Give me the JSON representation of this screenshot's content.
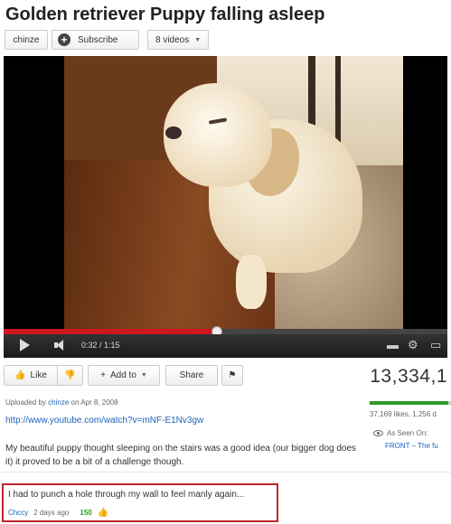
{
  "video": {
    "title": "Golden retriever Puppy falling asleep",
    "channel": "chinze",
    "subscribe_label": "Subscribe",
    "videos_label": "8 videos",
    "progress_fraction": 0.48
  },
  "player": {
    "time": "0:32 / 1:15"
  },
  "actions": {
    "like_label": "Like",
    "add_to_label": "Add to",
    "share_label": "Share"
  },
  "stats": {
    "views": "13,334,1",
    "likes_text": "37,169 likes, 1,256 d",
    "like_ratio": 0.967,
    "as_seen_on": "As Seen On:",
    "front_link": "FRONT – The fu"
  },
  "details": {
    "uploaded_prefix": "Uploaded by",
    "uploader": "chinze",
    "uploaded_date": "on Apr 8, 2008",
    "url": "http://www.youtube.com/watch?v=mNF-E1Nv3gw",
    "description": "My beautiful puppy thought sleeping on the stairs was a good idea (our bigger dog does it) it proved to be a bit of a challenge though."
  },
  "comment": {
    "text": "I had to punch a hole through my wall to feel manly again...",
    "author": "Chccy",
    "time": "2 days ago",
    "likes": "150"
  },
  "colors": {
    "progress": "#cc181e",
    "link": "#1c62b9",
    "like_bar": "#2b9b2b",
    "highlight_border": "#c0252b"
  }
}
